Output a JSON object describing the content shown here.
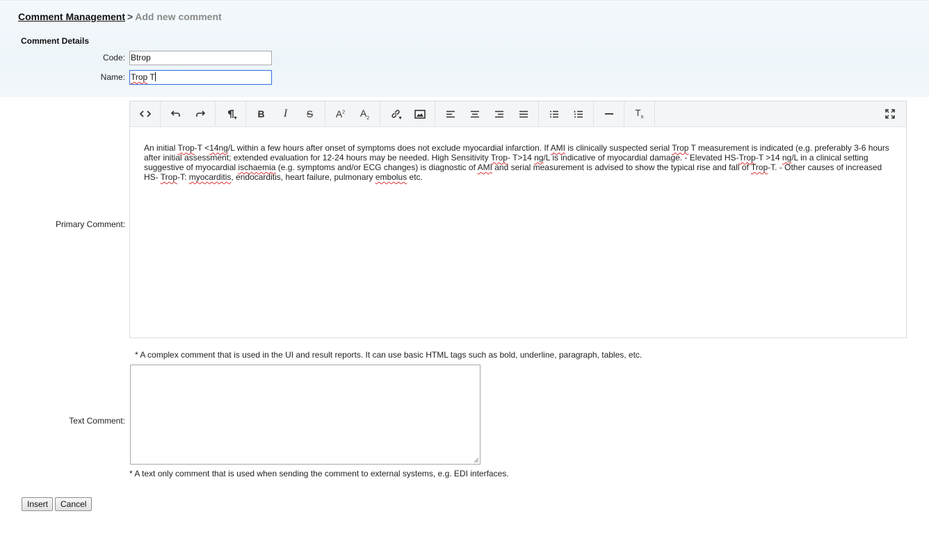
{
  "breadcrumb": {
    "link": "Comment Management",
    "separator": ">",
    "current": "Add new comment"
  },
  "section_title": "Comment Details",
  "form": {
    "code_label": "Code:",
    "code_value": "Btrop",
    "name_label": "Name:",
    "name_value_word1": "Trop",
    "name_value_word2": " T",
    "primary_label": "Primary Comment:",
    "text_label": "Text Comment:",
    "primary_hint": "* A complex comment that is used in the UI and result reports. It can use basic HTML tags such as bold, underline, paragraph, tables, etc.",
    "text_hint": "* A text only comment that is used when sending the comment to external systems, e.g. EDI interfaces."
  },
  "toolbar": {
    "icons": [
      "code-view-icon",
      "undo-icon",
      "redo-icon",
      "paragraph-format-icon",
      "bold-icon",
      "italic-icon",
      "strikethrough-icon",
      "superscript-icon",
      "subscript-icon",
      "insert-link-icon",
      "insert-image-icon",
      "align-left-icon",
      "align-center-icon",
      "align-right-icon",
      "align-justify-icon",
      "unordered-list-icon",
      "ordered-list-icon",
      "horizontal-line-icon",
      "clear-formatting-icon",
      "fullscreen-icon"
    ]
  },
  "primary_comment": {
    "segments": [
      {
        "t": "An initial "
      },
      {
        "t": "Trop",
        "s": true
      },
      {
        "t": "-T <"
      },
      {
        "t": "14ng",
        "s": true
      },
      {
        "t": "/L within a few hours after onset of symptoms does not exclude myocardial infarction. If "
      },
      {
        "t": "AMI",
        "s": true
      },
      {
        "t": " is clinically suspected serial "
      },
      {
        "t": "Trop",
        "s": true
      },
      {
        "t": " T measurement is indicated (e.g. preferably 3-6 hours after initial assessment; extended evaluation for 12-24 hours may be needed. High Sensitivity "
      },
      {
        "t": "Trop",
        "s": true
      },
      {
        "t": "- T>14 "
      },
      {
        "t": "ng",
        "s": true
      },
      {
        "t": "/L is indicative of myocardial damage. - Elevated HS-"
      },
      {
        "t": "Trop",
        "s": true
      },
      {
        "t": "-T >14 "
      },
      {
        "t": "ng",
        "s": true
      },
      {
        "t": "/L in a clinical setting suggestive of myocardial "
      },
      {
        "t": "ischaemia",
        "s": true
      },
      {
        "t": " (e.g. symptoms and/or ECG changes) is diagnostic of "
      },
      {
        "t": "AMI",
        "s": true
      },
      {
        "t": " and serial measurement is advised to show the typical rise and fall of "
      },
      {
        "t": "Trop",
        "s": true
      },
      {
        "t": "-T. - Other causes of increased HS- "
      },
      {
        "t": "Trop",
        "s": true
      },
      {
        "t": "-T: "
      },
      {
        "t": "myocarditis",
        "s": true
      },
      {
        "t": ", endocarditis, heart failure, pulmonary "
      },
      {
        "t": "embolus",
        "s": true
      },
      {
        "t": " etc."
      }
    ]
  },
  "text_comment": "",
  "buttons": {
    "insert": "Insert",
    "cancel": "Cancel"
  }
}
